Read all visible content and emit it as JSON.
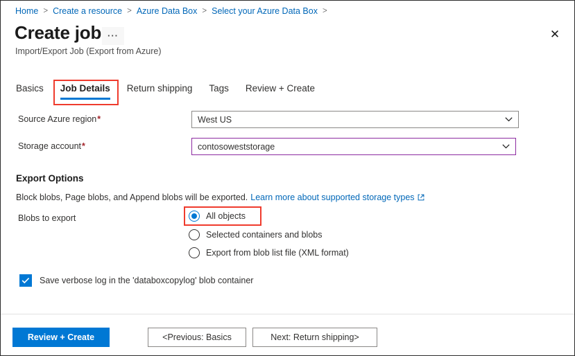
{
  "breadcrumb": {
    "items": [
      {
        "label": "Home"
      },
      {
        "label": "Create a resource"
      },
      {
        "label": "Azure Data Box"
      },
      {
        "label": "Select your Azure Data Box"
      }
    ],
    "separator": ">"
  },
  "header": {
    "title": "Create job",
    "more_label": "···",
    "more_icon": "ellipsis-icon",
    "subtitle": "Import/Export Job (Export from Azure)",
    "close_icon": "close-icon",
    "close_glyph": "✕"
  },
  "tabs": [
    {
      "label": "Basics",
      "active": false
    },
    {
      "label": "Job Details",
      "active": true
    },
    {
      "label": "Return shipping",
      "active": false
    },
    {
      "label": "Tags",
      "active": false
    },
    {
      "label": "Review + Create",
      "active": false
    }
  ],
  "form": {
    "source_region": {
      "label": "Source Azure region",
      "required_mark": "*",
      "value": "West US",
      "chevron_icon": "chevron-down-icon"
    },
    "storage_account": {
      "label": "Storage account",
      "required_mark": "*",
      "value": "contosoweststorage",
      "chevron_icon": "chevron-down-icon"
    }
  },
  "export_options": {
    "heading": "Export Options",
    "description": "Block blobs, Page blobs, and Append blobs will be exported.",
    "link_text": "Learn more about supported storage types",
    "link_icon": "external-link-icon",
    "blobs_label": "Blobs to export",
    "radios": [
      {
        "label": "All objects",
        "selected": true
      },
      {
        "label": "Selected containers and blobs",
        "selected": false
      },
      {
        "label": "Export from blob list file (XML format)",
        "selected": false
      }
    ],
    "verbose_log": {
      "label": "Save verbose log in the 'databoxcopylog' blob container",
      "checked": true,
      "check_icon": "checkmark-icon"
    }
  },
  "footer": {
    "primary": "Review + Create",
    "previous": "<Previous: Basics",
    "next": "Next: Return shipping>"
  },
  "colors": {
    "accent": "#0078d4",
    "link": "#0067b8",
    "annotation": "#ef3b2d",
    "focus_border": "#8c29a0",
    "required": "#a4262c"
  }
}
